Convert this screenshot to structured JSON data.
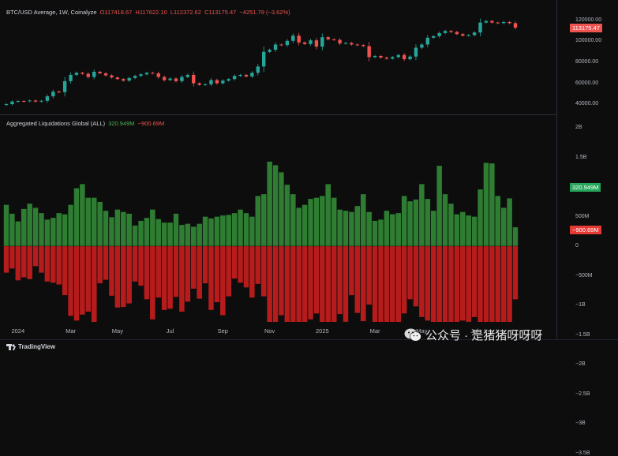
{
  "price_pane": {
    "symbol": "BTC/USD Average, 1W, Coinalyze",
    "open": "O117418.67",
    "high": "H117622.10",
    "low": "L112372.62",
    "close": "C113175.47",
    "change": "−4251.79 (−3.62%)",
    "price_tag": "113175.47",
    "up_color": "#26a69a",
    "down_color": "#ef5350"
  },
  "liq_pane": {
    "title": "Aggregated Liquidations Global (ALL)",
    "longs_value": "320.949M",
    "shorts_value": "−900.69M",
    "long_tag": "320.949M",
    "short_tag": "−900.69M",
    "long_color": "#2e7d32",
    "short_color": "#b71c1c"
  },
  "chart_data": [
    {
      "type": "candlestick",
      "title": "BTC/USD Average, 1W, Coinalyze",
      "y_ticks": [
        "120000.00",
        "100000.00",
        "80000.00",
        "60000.00",
        "40000.00"
      ],
      "ylim": [
        34000,
        126000
      ],
      "x_ticks": [
        "2024",
        "Mar",
        "May",
        "Jul",
        "Sep",
        "Nov",
        "2025",
        "Mar",
        "May",
        "Jul"
      ],
      "x_tick_weeks": [
        2,
        11,
        19,
        28,
        37,
        45,
        54,
        63,
        71,
        80
      ],
      "closes": [
        40000,
        42500,
        43000,
        42800,
        43500,
        42500,
        43200,
        47500,
        52000,
        51500,
        62000,
        68000,
        70000,
        69000,
        66000,
        71000,
        69500,
        67500,
        65500,
        64000,
        62500,
        65000,
        67000,
        68500,
        70000,
        69500,
        66000,
        63000,
        64500,
        62000,
        66000,
        68000,
        60000,
        58500,
        59000,
        63000,
        60000,
        62500,
        64000,
        67000,
        68000,
        66500,
        70000,
        76000,
        90000,
        92000,
        97000,
        96500,
        100500,
        105500,
        99000,
        97500,
        101000,
        95000,
        104000,
        102000,
        101500,
        98000,
        98500,
        97000,
        96500,
        95500,
        85000,
        86000,
        84500,
        83500,
        85000,
        87000,
        83000,
        85500,
        94000,
        97000,
        103500,
        105000,
        108000,
        110000,
        109000,
        107000,
        105500,
        106000,
        108500,
        118000,
        119500,
        118000,
        117500,
        118500,
        117418,
        113175
      ]
    },
    {
      "type": "bar",
      "title": "Aggregated Liquidations Global (ALL)",
      "y_ticks": [
        "2B",
        "1.5B",
        "1B",
        "500M",
        "0",
        "−500M",
        "−1B",
        "−1.5B",
        "−2B",
        "−2.5B",
        "−3B",
        "−3.5B"
      ],
      "ylim": [
        -3500,
        2000
      ],
      "unit": "M",
      "series": [
        {
          "name": "longs",
          "values": [
            700,
            550,
            420,
            630,
            720,
            650,
            560,
            450,
            480,
            560,
            540,
            700,
            980,
            1050,
            820,
            820,
            750,
            600,
            490,
            620,
            580,
            550,
            350,
            430,
            480,
            620,
            460,
            400,
            400,
            550,
            360,
            380,
            330,
            380,
            500,
            470,
            500,
            520,
            530,
            560,
            620,
            560,
            500,
            850,
            880,
            1430,
            1370,
            1250,
            1040,
            880,
            650,
            700,
            800,
            820,
            850,
            1050,
            820,
            620,
            600,
            580,
            680,
            880,
            580,
            430,
            450,
            600,
            540,
            560,
            850,
            760,
            790,
            1050,
            800,
            600,
            1360,
            880,
            720,
            540,
            580,
            520,
            500,
            960,
            1410,
            1400,
            850,
            650,
            810,
            321
          ]
        },
        {
          "name": "shorts",
          "values": [
            -450,
            -380,
            -580,
            -530,
            -560,
            -340,
            -450,
            -600,
            -620,
            -650,
            -830,
            -1180,
            -1260,
            -1160,
            -1110,
            -1760,
            -630,
            -570,
            -840,
            -1040,
            -1030,
            -970,
            -600,
            -670,
            -900,
            -1240,
            -870,
            -1080,
            -1060,
            -860,
            -1110,
            -940,
            -720,
            -890,
            -630,
            -1080,
            -950,
            -1170,
            -850,
            -550,
            -620,
            -700,
            -870,
            -640,
            -850,
            -1300,
            -1360,
            -1170,
            -1320,
            -1390,
            -1520,
            -1370,
            -1240,
            -1140,
            -1370,
            -1580,
            -1600,
            -1150,
            -1280,
            -830,
            -1130,
            -1270,
            -990,
            -1650,
            -1960,
            -1820,
            -1590,
            -1310,
            -1140,
            -900,
            -1020,
            -1200,
            -1260,
            -1420,
            -1550,
            -1460,
            -1580,
            -1620,
            -1260,
            -1280,
            -1200,
            -1460,
            -1560,
            -1670,
            -1400,
            -1900,
            -1570,
            -901
          ]
        }
      ]
    }
  ],
  "footer": {
    "brand": "TradingView",
    "watermark": "公众号 · 是猪猪呀呀呀"
  }
}
